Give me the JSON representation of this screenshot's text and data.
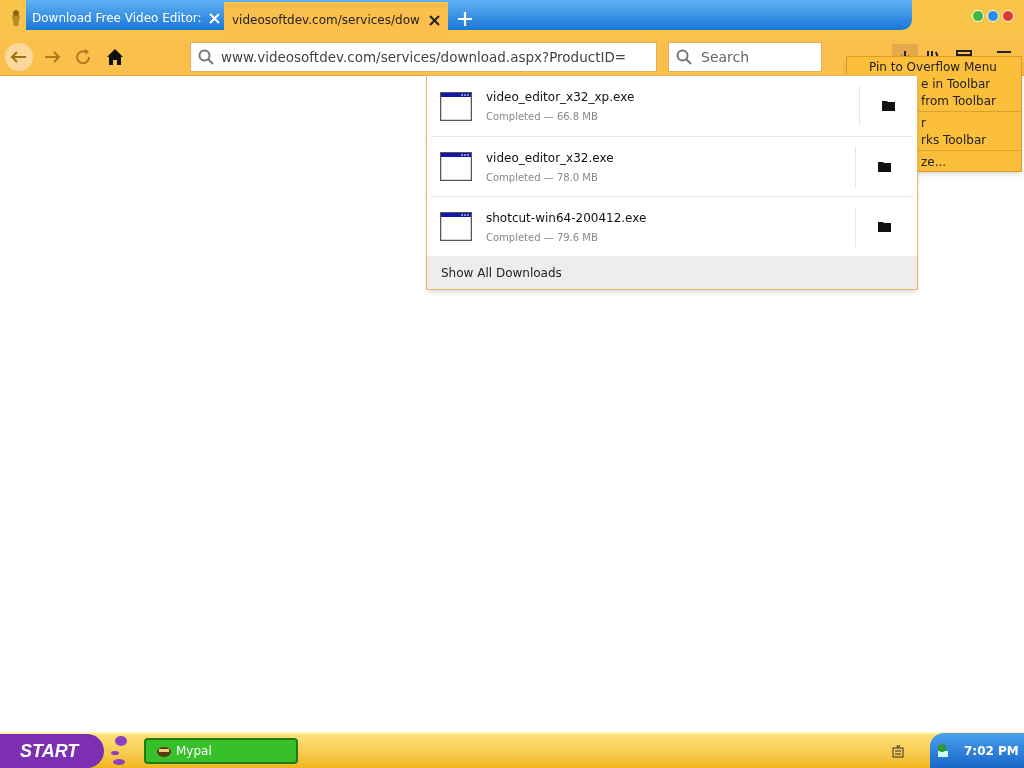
{
  "tabs": [
    {
      "title": "Download Free Video Editor:",
      "selected": false
    },
    {
      "title": "videosoftdev.com/services/dow",
      "selected": true
    }
  ],
  "address_bar": {
    "value": "www.videosoftdev.com/services/download.aspx?ProductID="
  },
  "search": {
    "placeholder": "Search"
  },
  "downloads": {
    "items": [
      {
        "filename": "video_editor_x32_xp.exe",
        "status": "Completed — 66.8 MB"
      },
      {
        "filename": "video_editor_x32.exe",
        "status": "Completed — 78.0 MB"
      },
      {
        "filename": "shotcut-win64-200412.exe",
        "status": "Completed — 79.6 MB"
      }
    ],
    "footer": "Show All Downloads"
  },
  "context_menu": {
    "sections": [
      [
        "Pin to Overflow Menu",
        "e in Toolbar",
        "from Toolbar"
      ],
      [
        "r",
        "rks Toolbar"
      ],
      [
        "ze..."
      ]
    ]
  },
  "taskbar": {
    "start": "START",
    "tasks": [
      {
        "label": "Mypal"
      }
    ],
    "clock": "7:02 PM"
  }
}
